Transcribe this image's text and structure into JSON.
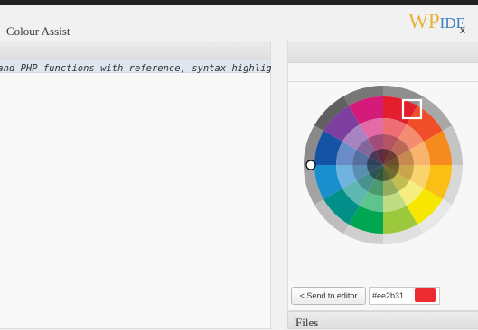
{
  "brand": {
    "logo_main": "WP",
    "logo_suffix": "IDE"
  },
  "editor": {
    "line_text": "ess and PHP functions with reference, syntax highlighting, ..."
  },
  "colour_assist": {
    "title": "Colour Assist",
    "close_label": "x",
    "send_button_label": "< Send to editor",
    "hex_value": "#ee2b31",
    "selected_color": "#ee2b31",
    "outer_ring_colors": [
      "#777777",
      "#8e8e8e",
      "#a8a8a8",
      "#c4c4c4",
      "#d8d8d8",
      "#e8e8e8",
      "#e0e0e0",
      "#cfcfcf",
      "#bdbdbd",
      "#a3a3a3",
      "#8a8a8a",
      "#606060"
    ],
    "hue_ring_colors": [
      "#d41b7a",
      "#e31e2d",
      "#ef4e29",
      "#f58a1f",
      "#fbbe14",
      "#f6e600",
      "#9cc93b",
      "#00a651",
      "#009089",
      "#1a8fce",
      "#1452a3",
      "#7d3fa0"
    ],
    "mid_ring_colors": [
      "#e46aa8",
      "#ef6e76",
      "#f48c6f",
      "#f8b46d",
      "#fbd36d",
      "#f7ee80",
      "#c1dd83",
      "#5fc38d",
      "#5fb7b3",
      "#70b3de",
      "#6a8cc8",
      "#a783c2"
    ],
    "inner_ring_colors": [
      "#a24c7a",
      "#b55462",
      "#bc6a57",
      "#c48a50",
      "#c9a54c",
      "#c6bd52",
      "#95ad5e",
      "#4a9a6e",
      "#49918f",
      "#5b8eb3",
      "#566fa0",
      "#82669b"
    ],
    "core_ring_colors": [
      "#5b2a45",
      "#653034",
      "#6a3d30",
      "#6e4f2c",
      "#715f2b",
      "#706b2d",
      "#546234",
      "#2b583e",
      "#2a5451",
      "#345066",
      "#313f5b",
      "#4a3958"
    ]
  },
  "files_panel": {
    "title": "Files"
  }
}
